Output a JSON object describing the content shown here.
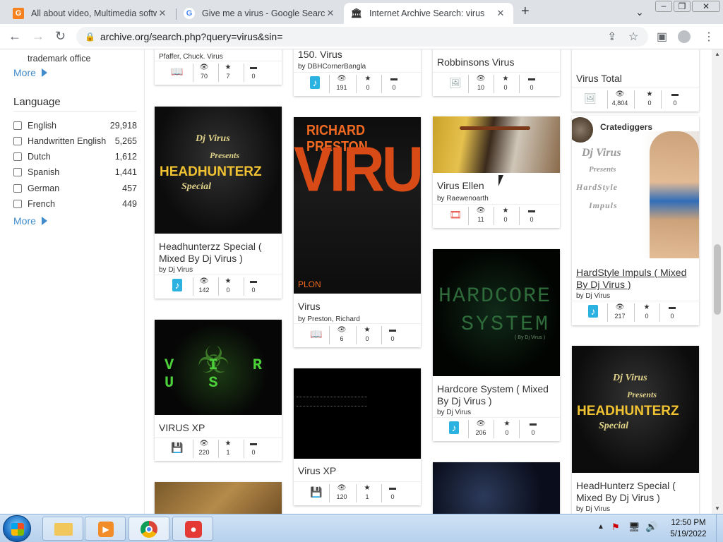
{
  "browser": {
    "tabs": [
      {
        "title": "All about video, Multimedia softw",
        "icon": "g-orange-icon",
        "active": false
      },
      {
        "title": "Give me a virus - Google Search",
        "icon": "google-icon",
        "active": false
      },
      {
        "title": "Internet Archive Search: virus",
        "icon": "archive-icon",
        "active": true
      }
    ],
    "url": "archive.org/search.php?query=virus&sin="
  },
  "sidebar": {
    "top_facet_tail": "trademark office",
    "more_label": "More",
    "language_title": "Language",
    "languages": [
      {
        "label": "English",
        "count": "29,918"
      },
      {
        "label": "Handwritten English",
        "count": "5,265"
      },
      {
        "label": "Dutch",
        "count": "1,612"
      },
      {
        "label": "Spanish",
        "count": "1,441"
      },
      {
        "label": "German",
        "count": "457"
      },
      {
        "label": "French",
        "count": "449"
      }
    ]
  },
  "results": {
    "col1": [
      {
        "by": "Pfaffer, Chuck. Virus",
        "type": "book",
        "views": "70",
        "favs": "7",
        "reviews": "0"
      },
      {
        "title": "Headhunterzz Special ( Mixed By Dj Virus )",
        "by": "by Dj Virus",
        "type": "audio",
        "views": "142",
        "favs": "0",
        "reviews": "0",
        "art": [
          "Dj Virus",
          "Presents",
          "HEADHUNTERZ",
          "Special"
        ]
      },
      {
        "title": "VIRUS XP",
        "type": "software",
        "views": "220",
        "favs": "1",
        "reviews": "0",
        "art": [
          "V I R U S"
        ]
      }
    ],
    "col2": [
      {
        "title": "150. Virus",
        "by": "by DBHCornerBangla",
        "type": "audio",
        "views": "191",
        "favs": "0",
        "reviews": "0"
      },
      {
        "title": "Virus",
        "by": "by Preston, Richard",
        "type": "book",
        "views": "6",
        "favs": "0",
        "reviews": "0",
        "art": [
          "RICHARD PRESTON",
          "VIRUS",
          "PLON"
        ]
      },
      {
        "title": "Virus XP",
        "type": "software",
        "views": "120",
        "favs": "1",
        "reviews": "0"
      }
    ],
    "col3": [
      {
        "title": "Robbinsons Virus",
        "type": "image",
        "views": "10",
        "favs": "0",
        "reviews": "0"
      },
      {
        "title": "Virus Ellen",
        "by": "by Raewenoarth",
        "type": "movies",
        "views": "11",
        "favs": "0",
        "reviews": "0"
      },
      {
        "title": "Hardcore System ( Mixed By Dj Virus )",
        "by": "by Dj Virus",
        "type": "audio",
        "views": "206",
        "favs": "0",
        "reviews": "0",
        "art": [
          "HARDCORE",
          "SYSTEM",
          "( By Dj Virus )"
        ]
      }
    ],
    "col4": [
      {
        "title": "Virus Total",
        "type": "image",
        "views": "4,804",
        "favs": "0",
        "reviews": "0"
      },
      {
        "collection": "Cratediggers",
        "title": "HardStyle Impuls ( Mixed By Dj Virus )",
        "by": "by Dj Virus",
        "type": "audio",
        "views": "217",
        "favs": "0",
        "reviews": "0",
        "art": [
          "Dj Virus",
          "Presents",
          "HardStyle",
          "Impuls"
        ]
      },
      {
        "title": "HeadHunterz Special ( Mixed By Dj Virus )",
        "by": "by Dj Virus",
        "art": [
          "Dj Virus",
          "Presents",
          "HEADHUNTERZ",
          "Special"
        ]
      }
    ]
  },
  "taskbar": {
    "time": "12:50 PM",
    "date": "5/19/2022"
  }
}
